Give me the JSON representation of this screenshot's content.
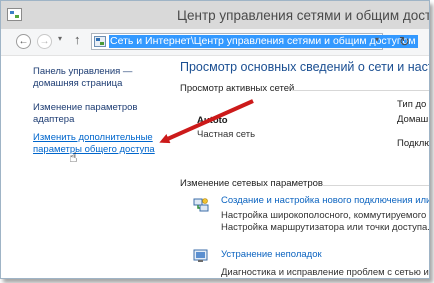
{
  "window": {
    "title": "Центр управления сетями и общим доступом"
  },
  "toolbar": {
    "address_path": "Сеть и Интернет\\Центр управления сетями и общим доступом",
    "back_glyph": "←",
    "forward_glyph": "→",
    "history_glyph": "▾",
    "up_glyph": "↑",
    "dropdown_glyph": "▾",
    "refresh_glyph": "↻"
  },
  "sidebar": {
    "home_line1": "Панель управления —",
    "home_line2": "домашняя страница",
    "adapter_line1": "Изменение параметров",
    "adapter_line2": "адаптера",
    "sharing_line1": "Изменить дополнительные",
    "sharing_line2": "параметры общего доступа"
  },
  "main": {
    "heading": "Просмотр основных сведений о сети и настро",
    "active_networks_label": "Просмотр активных сетей",
    "network_name": "Autoto",
    "network_type": "Частная сеть",
    "right_col": [
      "Тип до",
      "Домаш",
      "Подклю"
    ],
    "change_settings_label": "Изменение сетевых параметров",
    "tasks": [
      {
        "link": "Создание и настройка нового подключения или с",
        "desc1": "Настройка широкополосного, коммутируемого",
        "desc2": "Настройка маршрутизатора или точки доступа.",
        "icon": "network-setup-icon"
      },
      {
        "link": "Устранение неполадок",
        "desc1": "Диагностика и исправление проблем с сетью и",
        "icon": "troubleshoot-icon"
      }
    ]
  },
  "overlay": {
    "arrow_color": "#cc1a1a",
    "cursor_icon": "hand-cursor-icon"
  }
}
